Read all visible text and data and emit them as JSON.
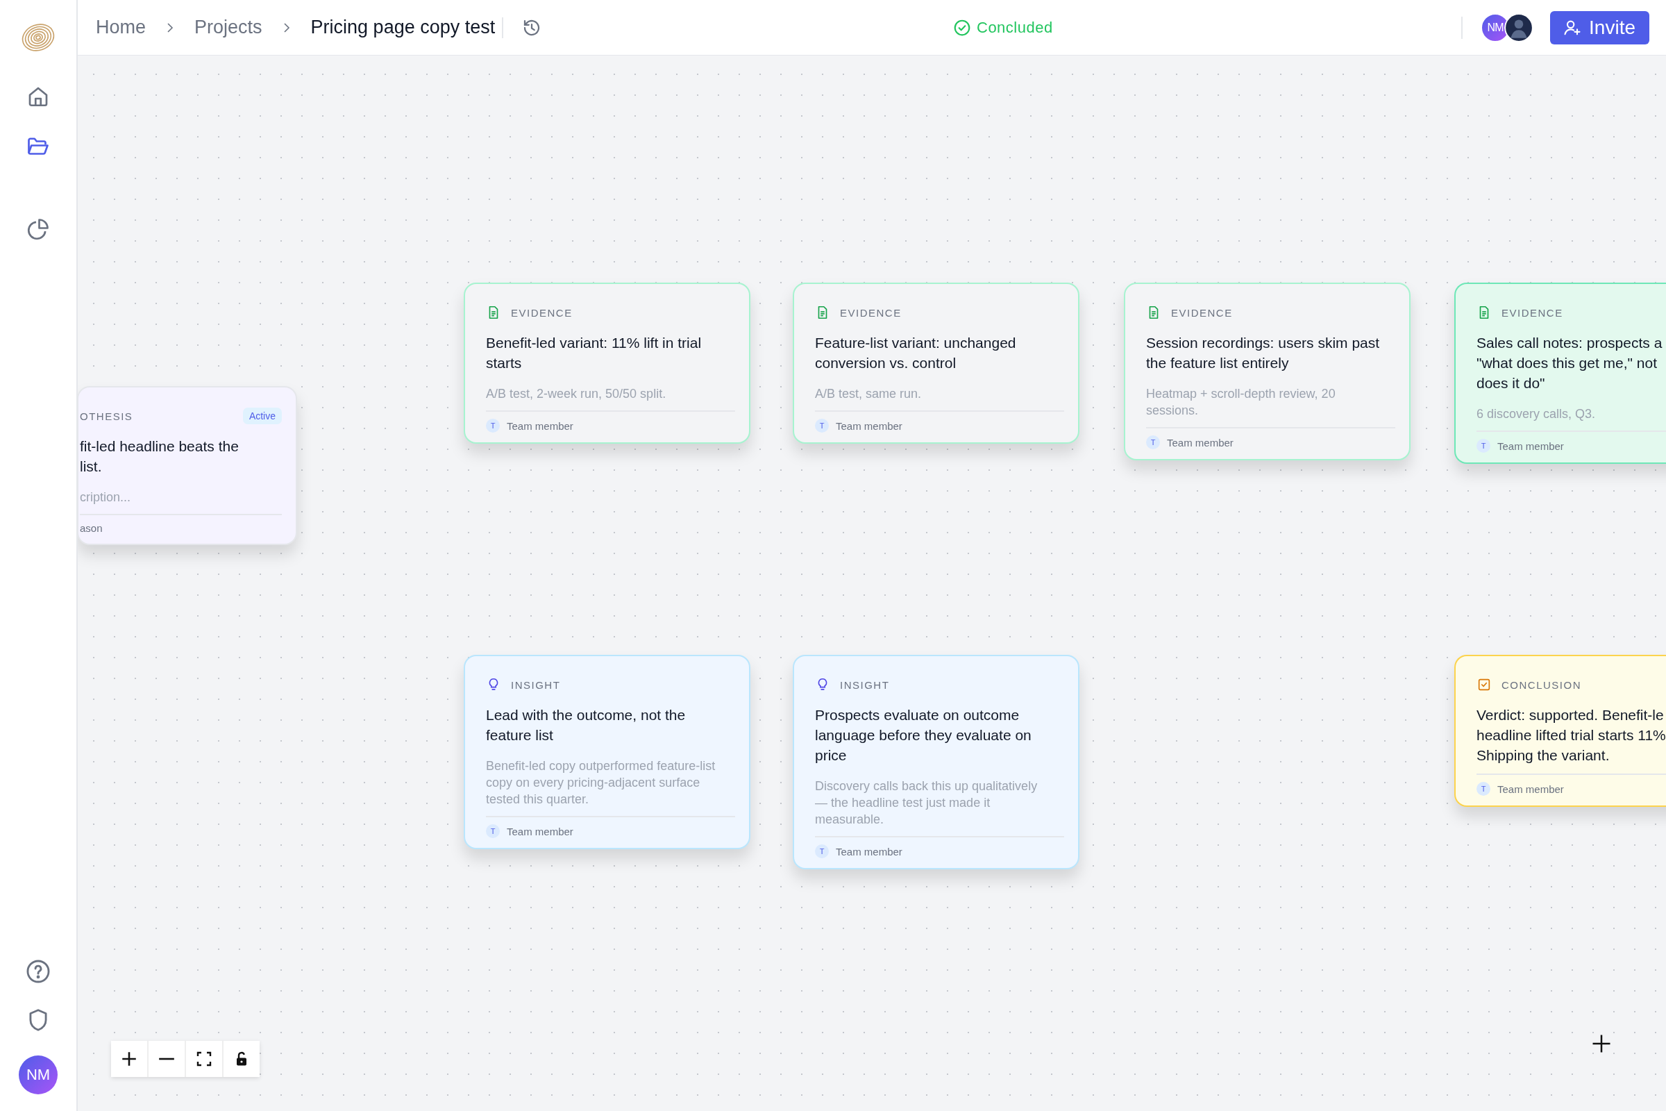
{
  "breadcrumb": [
    "Home",
    "Projects",
    "Pricing page copy test"
  ],
  "status": {
    "label": "Concluded"
  },
  "collaborators": [
    {
      "kind": "initials",
      "initials": "NM"
    },
    {
      "kind": "photo"
    }
  ],
  "invite_button": "Invite",
  "sidebar": {
    "items": [
      {
        "kind": "home",
        "selected": false
      },
      {
        "kind": "folder",
        "selected": true
      },
      {
        "kind": "chart",
        "selected": false
      }
    ],
    "bottom_items": [
      {
        "kind": "help"
      },
      {
        "kind": "shield"
      }
    ],
    "user": {
      "initials": "NM"
    }
  },
  "cards": [
    {
      "kind": "hypothesis",
      "label": "OTHESIS",
      "badge": "Active",
      "title_lines": [
        "fit-led headline beats the",
        "list."
      ],
      "description": "cription...",
      "author": "ason"
    },
    {
      "kind": "evidence",
      "label": "EVIDENCE",
      "title": "Benefit-led variant: 11% lift in trial starts",
      "description": "A/B test, 2-week run, 50/50 split.",
      "author_initial": "T",
      "author": "Team member",
      "highlighted": false
    },
    {
      "kind": "evidence",
      "label": "EVIDENCE",
      "title": "Feature-list variant: unchanged conversion vs. control",
      "description": "A/B test, same run.",
      "author_initial": "T",
      "author": "Team member",
      "highlighted": false
    },
    {
      "kind": "evidence",
      "label": "EVIDENCE",
      "title": "Session recordings: users skim past the feature list entirely",
      "description": "Heatmap + scroll-depth review, 20 sessions.",
      "author_initial": "T",
      "author": "Team member",
      "highlighted": false
    },
    {
      "kind": "evidence",
      "label": "EVIDENCE",
      "title_lines": [
        "Sales call notes: prospects a",
        "\"what does this get me,\" not",
        "does it do\""
      ],
      "description": "6 discovery calls, Q3.",
      "author_initial": "T",
      "author": "Team member",
      "highlighted": true
    },
    {
      "kind": "insight",
      "label": "INSIGHT",
      "title": "Lead with the outcome, not the feature list",
      "description": "Benefit-led copy outperformed feature-list copy on every pricing-adjacent surface tested this quarter.",
      "author_initial": "T",
      "author": "Team member"
    },
    {
      "kind": "insight",
      "label": "INSIGHT",
      "title": "Prospects evaluate on outcome language before they evaluate on price",
      "description": "Discovery calls back this up qualitatively — the headline test just made it measurable.",
      "author_initial": "T",
      "author": "Team member"
    },
    {
      "kind": "conclusion",
      "label": "CONCLUSION",
      "title_lines": [
        "Verdict: supported. Benefit-le",
        "headline lifted trial starts 11%",
        "Shipping the variant."
      ],
      "author_initial": "T",
      "author": "Team member"
    }
  ],
  "zoom_controls": [
    {
      "kind": "zoom-in"
    },
    {
      "kind": "zoom-out"
    },
    {
      "kind": "fit"
    },
    {
      "kind": "lock"
    }
  ],
  "add_node": {
    "shown": true
  }
}
